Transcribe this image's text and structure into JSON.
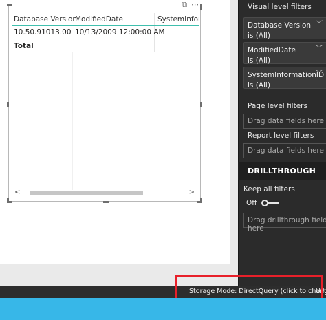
{
  "table": {
    "columns": [
      "Database Version",
      "ModifiedDate",
      "SystemInform"
    ],
    "rows": [
      [
        "10.50.91013.00",
        "10/13/2009 12:00:00 AM",
        ""
      ]
    ],
    "total_label": "Total"
  },
  "filters": {
    "visual_level_title": "Visual level filters",
    "cards": [
      {
        "field": "Database Version",
        "state": "is (All)"
      },
      {
        "field": "ModifiedDate",
        "state": "is (All)"
      },
      {
        "field": "SystemInformationID",
        "state": "is (All)"
      }
    ],
    "page_level_title": "Page level filters",
    "page_dropzone": "Drag data fields here",
    "report_level_title": "Report level filters",
    "report_dropzone": "Drag data fields here"
  },
  "drillthrough": {
    "title": "DRILLTHROUGH",
    "keep_all_filters_label": "Keep all filters",
    "toggle_state": "Off",
    "dropzone": "Drag drillthrough fields here"
  },
  "statusbar": {
    "storage_mode": "Storage Mode: DirectQuery (click to change)",
    "right_text": "UP"
  },
  "colors": {
    "accent_teal": "#3fbfad",
    "highlight_red": "#e8202a",
    "taskbar_blue": "#37b7e8",
    "pane_dark": "#2b2b2b"
  }
}
